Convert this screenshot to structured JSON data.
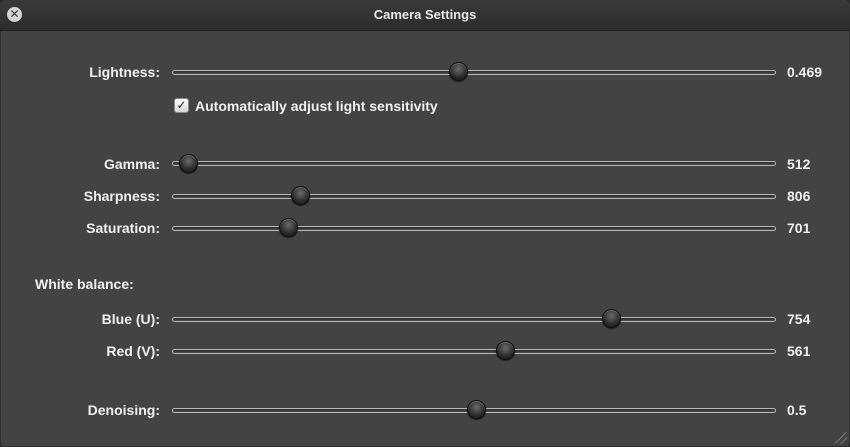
{
  "window": {
    "title": "Camera Settings",
    "close_glyph": "✕"
  },
  "controls": {
    "lightness": {
      "label": "Lightness:",
      "value": "0.469",
      "position": 0.469
    },
    "auto_light": {
      "label": "Automatically adjust light sensitivity",
      "checked": true,
      "check_glyph": "✓"
    },
    "gamma": {
      "label": "Gamma:",
      "value": "512",
      "position": 0.01
    },
    "sharpness": {
      "label": "Sharpness:",
      "value": "806",
      "position": 0.2
    },
    "saturation": {
      "label": "Saturation:",
      "value": "701",
      "position": 0.18
    },
    "white_balance": {
      "label": "White balance:"
    },
    "blue_u": {
      "label": "Blue (U):",
      "value": "754",
      "position": 0.73
    },
    "red_v": {
      "label": "Red (V):",
      "value": "561",
      "position": 0.55
    },
    "denoising": {
      "label": "Denoising:",
      "value": "0.5",
      "position": 0.5
    }
  }
}
